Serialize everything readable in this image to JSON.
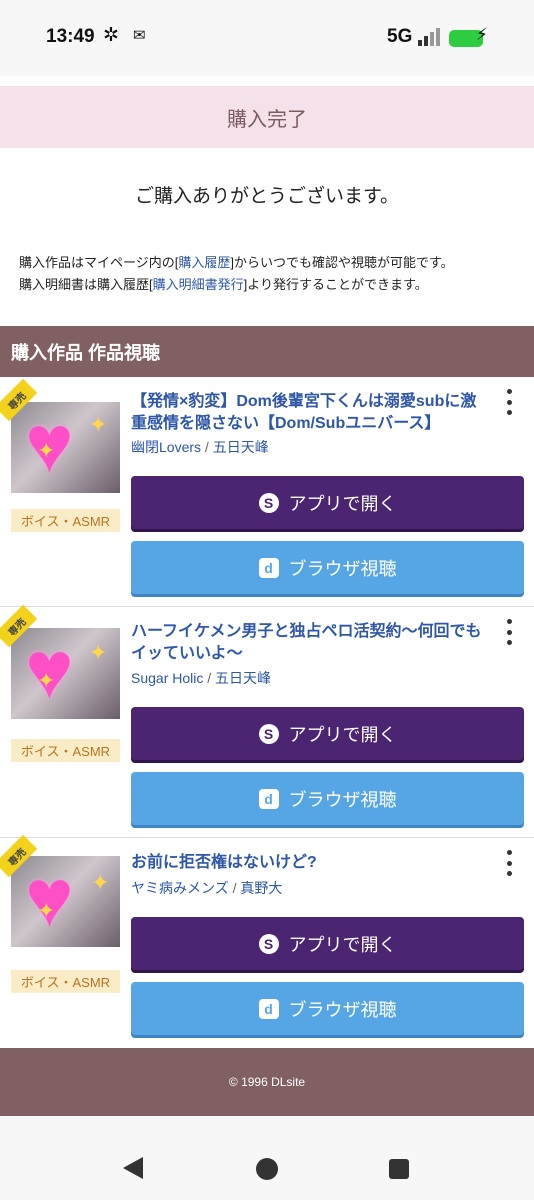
{
  "status_bar": {
    "time": "13:49",
    "icons": [
      "fan-icon",
      "mail-icon"
    ],
    "network": "5G",
    "battery_color": "#2ecc40"
  },
  "page": {
    "title": "購入完了",
    "thanks": "ご購入ありがとうございます。",
    "info_line1_pre": "購入作品はマイページ内の[",
    "info_line1_link": "購入履歴",
    "info_line1_post": "]からいつでも確認や視聴が可能です。",
    "info_line2_pre": "購入明細書は購入履歴[",
    "info_line2_link": "購入明細書発行",
    "info_line2_post": "]より発行することができます。",
    "section_title": "購入作品 作品視聴"
  },
  "colors": {
    "title_band": "#f5e1ea",
    "section": "#806062",
    "link": "#2f56a8",
    "app_button": "#4b2472",
    "browser_button": "#56a6e6",
    "genre_badge_bg": "#fbecc8",
    "genre_badge_text": "#b7741e"
  },
  "items": [
    {
      "ribbon": "専売",
      "genre": "ボイス・ASMR",
      "title": "【発情×豹変】Dom後輩宮下くんは溺愛subに激重感情を隠さない【Dom/Subユニバース】",
      "circle": "幽閉Lovers",
      "author": "五日天峰",
      "app_button": "アプリで開く",
      "browser_button": "ブラウザ視聴"
    },
    {
      "ribbon": "専売",
      "genre": "ボイス・ASMR",
      "title": "ハーフイケメン男子と独占ペロ活契約〜何回でもイッていいよ〜",
      "circle": "Sugar Holic",
      "author": "五日天峰",
      "app_button": "アプリで開く",
      "browser_button": "ブラウザ視聴"
    },
    {
      "ribbon": "専売",
      "genre": "ボイス・ASMR",
      "title": "お前に拒否権はないけど?",
      "circle": "ヤミ病みメンズ",
      "author": "真野大",
      "app_button": "アプリで開く",
      "browser_button": "ブラウザ視聴"
    }
  ],
  "footer": {
    "copyright": "© 1996 DLsite"
  },
  "nav": {
    "icons": [
      "back-icon",
      "home-icon",
      "recents-icon"
    ]
  }
}
